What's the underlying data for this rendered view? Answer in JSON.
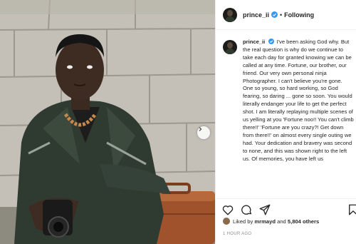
{
  "post": {
    "username": "prince_ii",
    "follow_state": "Following",
    "separator": "•",
    "caption_username": "prince_ii",
    "caption_text": "I've been asking God why. But the real question is why do we continue to take each day for granted knowing we can be called at any time. Fortune, our brother, our friend. Our very own personal ninja Photographer. I can't believe you're gone. One so young, so hard working, so God fearing, so daring ... gone so soon. You would literally endanger your life to get the perfect shot. I am literally replaying multiple scenes of us yelling at you 'Fortune noo!! You can't climb there!!' 'Fortune are you crazy?! Get down from there!!' on almost every single outing we had. Your dedication and bravery was second to none, and this was shown right to the left us. Of memories, you have left us",
    "likes": {
      "prefix": "Liked by",
      "user": "mrmayd",
      "conjunction": "and",
      "count_text": "5,804 others"
    },
    "timestamp": "1 HOUR AGO"
  },
  "colors": {
    "verified_blue": "#3897f0",
    "text": "#262626",
    "muted": "#8e8e8e"
  },
  "icons": [
    "verified-badge-icon",
    "heart-icon",
    "comment-icon",
    "share-icon",
    "bookmark-icon",
    "chevron-right-icon"
  ]
}
